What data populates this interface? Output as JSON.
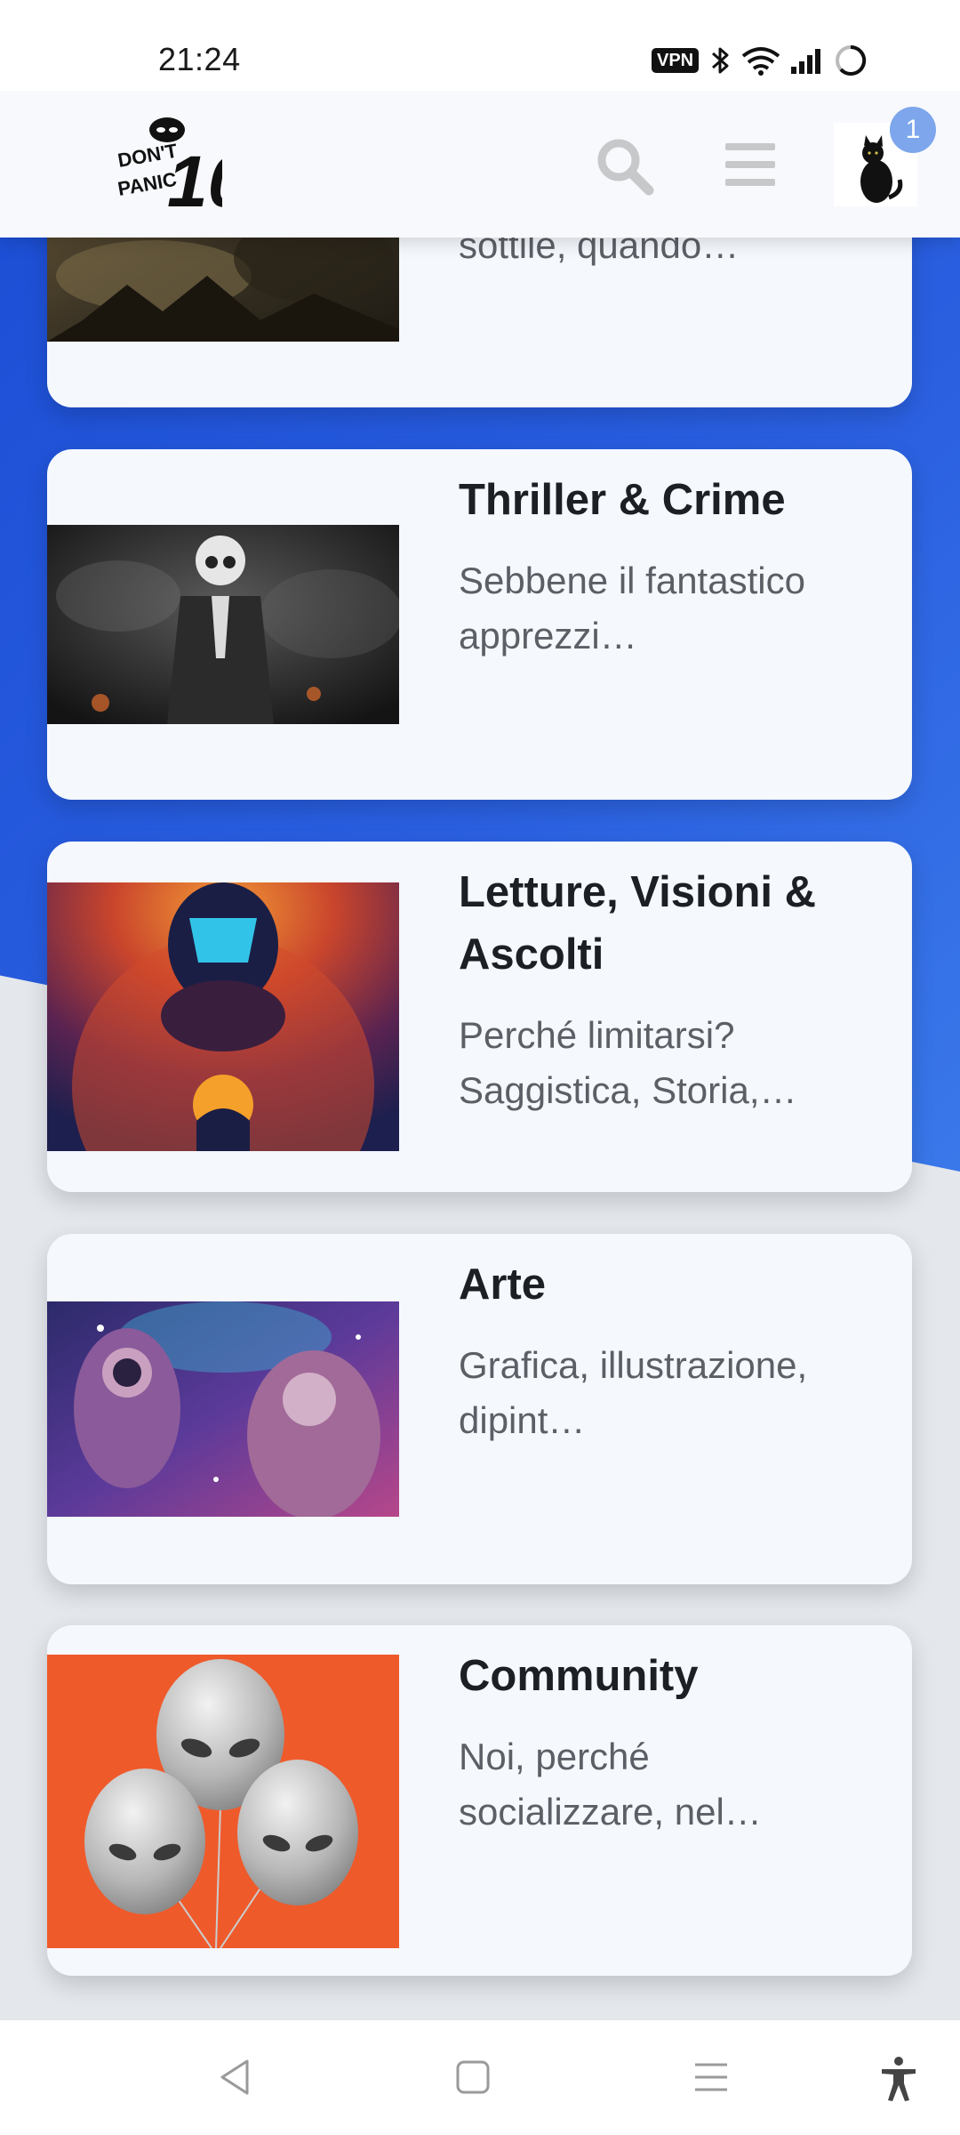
{
  "status": {
    "time": "21:24",
    "vpn": "VPN",
    "icons": [
      "bluetooth-icon",
      "wifi-icon",
      "signal-icon",
      "battery-icon"
    ]
  },
  "header": {
    "logo_text": "DON'T PANIC 10",
    "icons": [
      "search-icon",
      "hamburger-menu-icon",
      "cat-avatar"
    ],
    "notification_count": "1",
    "accent": "#7da6ec"
  },
  "colors": {
    "blue": "#2a5fe0",
    "card_bg": "#f5f8fd",
    "page_bg": "#e4e7ec"
  },
  "cards": [
    {
      "title": "",
      "description": "sottile, quando…"
    },
    {
      "title": "Thriller & Crime",
      "description": "Sebbene il fantastico apprezzi…"
    },
    {
      "title": "Letture, Visioni & Ascolti",
      "description": "Perché limitarsi? Saggistica, Storia,…"
    },
    {
      "title": "Arte",
      "description": "Grafica, illustrazione, dipint…"
    },
    {
      "title": "Community",
      "description": "Noi, perché socializzare, nel…"
    }
  ],
  "navbar": {
    "icons": [
      "back-icon",
      "home-icon",
      "recents-icon",
      "accessibility-icon"
    ]
  }
}
